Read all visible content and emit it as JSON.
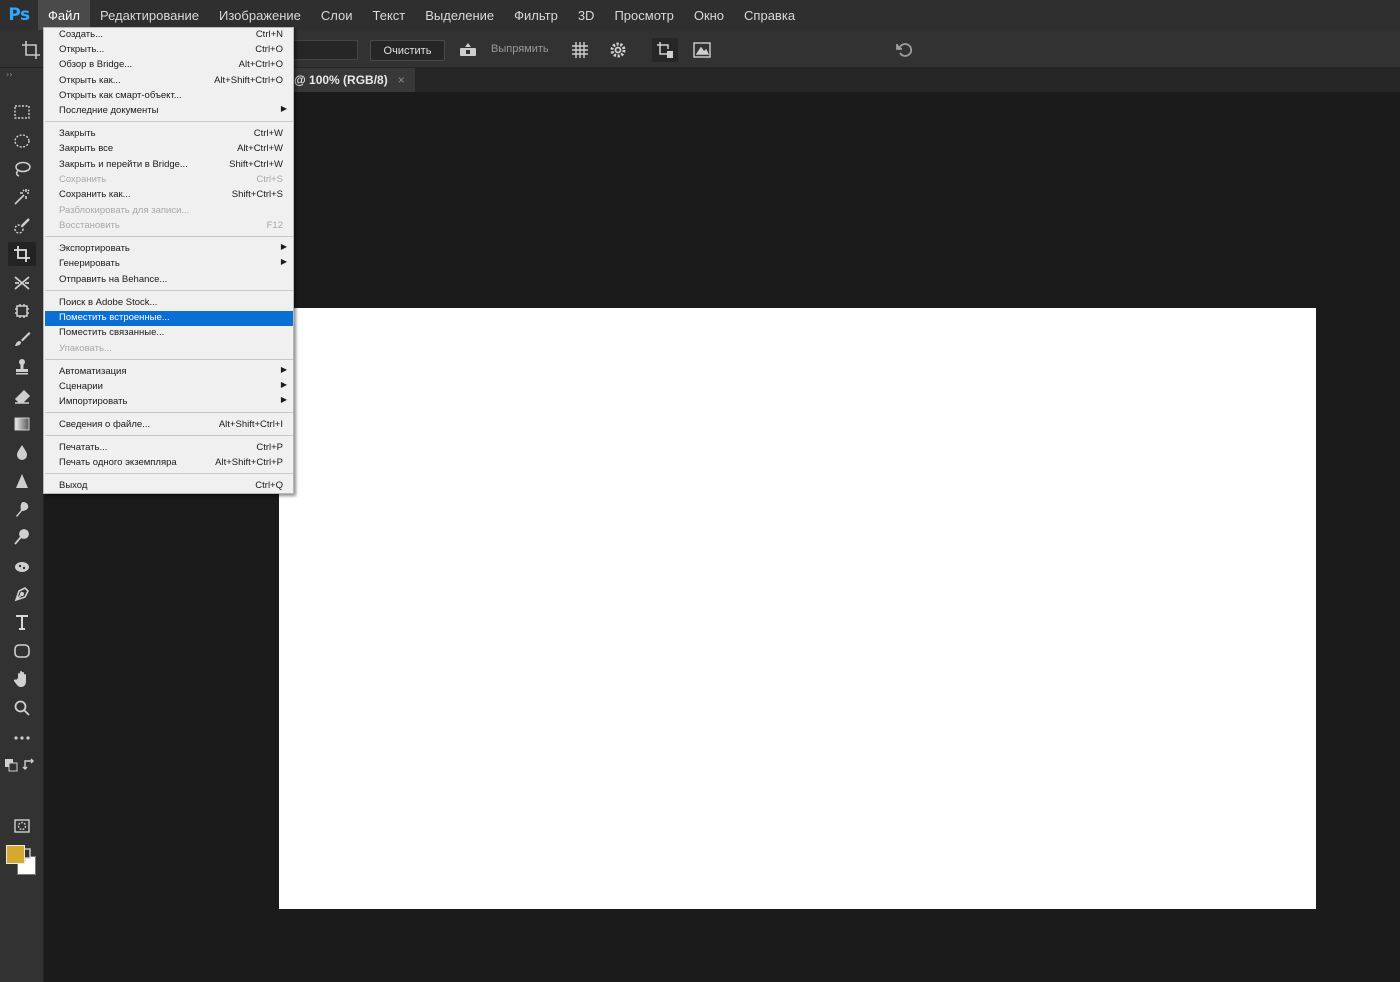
{
  "app": {
    "logo": "Ps",
    "accent": "#31a8ff"
  },
  "menubar": {
    "items": [
      "Файл",
      "Редактирование",
      "Изображение",
      "Слои",
      "Текст",
      "Выделение",
      "Фильтр",
      "3D",
      "Просмотр",
      "Окно",
      "Справка"
    ],
    "active_index": 0
  },
  "options": {
    "clear_label": "Очистить",
    "straighten_label": "Выпрямить"
  },
  "document_tab": {
    "title": "@ 100% (RGB/8)",
    "close": "×"
  },
  "colors": {
    "foreground": "#d3aa2e",
    "background": "#ffffff",
    "menu_highlight": "#0a6fd4"
  },
  "file_menu": {
    "items": [
      {
        "label": "Создать...",
        "shortcut": "Ctrl+N",
        "state": "enabled"
      },
      {
        "label": "Открыть...",
        "shortcut": "Ctrl+O",
        "state": "enabled"
      },
      {
        "label": "Обзор в Bridge...",
        "shortcut": "Alt+Ctrl+O",
        "state": "enabled"
      },
      {
        "label": "Открыть как...",
        "shortcut": "Alt+Shift+Ctrl+O",
        "state": "enabled"
      },
      {
        "label": "Открыть как смарт-объект...",
        "shortcut": "",
        "state": "enabled"
      },
      {
        "label": "Последние документы",
        "shortcut": "",
        "state": "enabled",
        "submenu": true
      },
      {
        "label": "Закрыть",
        "shortcut": "Ctrl+W",
        "state": "enabled"
      },
      {
        "label": "Закрыть все",
        "shortcut": "Alt+Ctrl+W",
        "state": "enabled"
      },
      {
        "label": "Закрыть и перейти в Bridge...",
        "shortcut": "Shift+Ctrl+W",
        "state": "enabled"
      },
      {
        "label": "Сохранить",
        "shortcut": "Ctrl+S",
        "state": "disabled"
      },
      {
        "label": "Сохранить как...",
        "shortcut": "Shift+Ctrl+S",
        "state": "enabled"
      },
      {
        "label": "Разблокировать для записи...",
        "shortcut": "",
        "state": "disabled"
      },
      {
        "label": "Восстановить",
        "shortcut": "F12",
        "state": "disabled"
      },
      {
        "label": "Экспортировать",
        "shortcut": "",
        "state": "enabled",
        "submenu": true
      },
      {
        "label": "Генерировать",
        "shortcut": "",
        "state": "enabled",
        "submenu": true
      },
      {
        "label": "Отправить на Behance...",
        "shortcut": "",
        "state": "enabled"
      },
      {
        "label": "Поиск в Adobe Stock...",
        "shortcut": "",
        "state": "enabled"
      },
      {
        "label": "Поместить встроенные...",
        "shortcut": "",
        "state": "highlighted"
      },
      {
        "label": "Поместить связанные...",
        "shortcut": "",
        "state": "enabled"
      },
      {
        "label": "Упаковать...",
        "shortcut": "",
        "state": "disabled"
      },
      {
        "label": "Автоматизация",
        "shortcut": "",
        "state": "enabled",
        "submenu": true
      },
      {
        "label": "Сценарии",
        "shortcut": "",
        "state": "enabled",
        "submenu": true
      },
      {
        "label": "Импортировать",
        "shortcut": "",
        "state": "enabled",
        "submenu": true
      },
      {
        "label": "Сведения о файле...",
        "shortcut": "Alt+Shift+Ctrl+I",
        "state": "enabled"
      },
      {
        "label": "Печатать...",
        "shortcut": "Ctrl+P",
        "state": "enabled"
      },
      {
        "label": "Печать одного экземпляра",
        "shortcut": "Alt+Shift+Ctrl+P",
        "state": "enabled"
      },
      {
        "label": "Выход",
        "shortcut": "Ctrl+Q",
        "state": "enabled"
      }
    ],
    "submenu_arrow": "▶"
  }
}
